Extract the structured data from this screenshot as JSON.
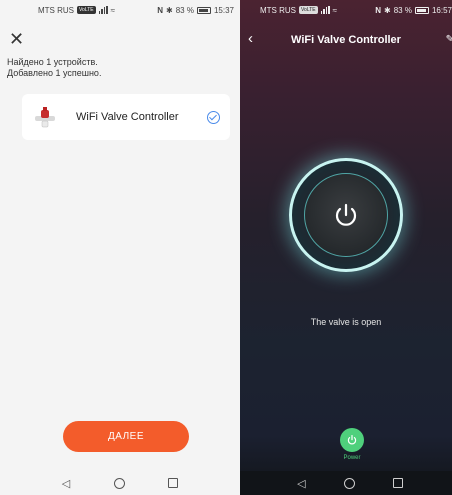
{
  "left_screen": {
    "status_bar": {
      "carrier": "MTS RUS",
      "volte": "VoLTE",
      "nfc": "N",
      "battery": "83 %",
      "time": "15:37"
    },
    "found_line1": "Найдено 1 устройств.",
    "found_line2": "Добавлено 1 успешно.",
    "device_name": "WiFi Valve Controller",
    "next_button": "ДАЛЕЕ"
  },
  "right_screen": {
    "status_bar": {
      "carrier": "MTS RUS",
      "volte": "VoLTE",
      "nfc": "N",
      "battery": "83 %",
      "time": "16:57"
    },
    "title": "WiFi Valve Controller",
    "status": "The valve is open",
    "power_label": "Power"
  },
  "nav_icons": [
    "back-triangle-icon",
    "home-circle-icon",
    "recent-square-icon"
  ],
  "colors": {
    "accent_orange": "#f35c2b",
    "check_blue": "#4a8bea",
    "power_green": "#4fd07c",
    "ring_glow": "#c8f4f1"
  }
}
